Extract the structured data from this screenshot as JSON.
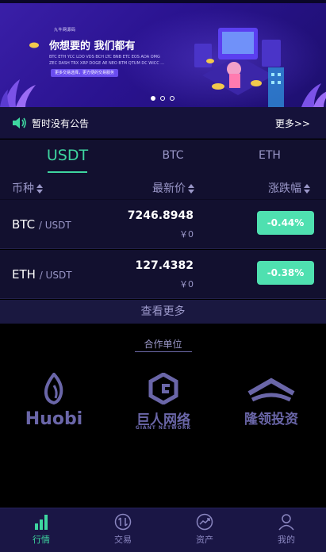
{
  "banner": {
    "brand": "九牛网源码",
    "headline": "你想要的 我们都有",
    "subtitle": "BTC ETH YCC LDO VDS BCH LTC BNB ETC EOS ADA OMG ZEC DASH TRX XRP DOGE AE NEO BTM QTUM DC WICC ...",
    "cta": "更多交易选择，更方便的交易服务",
    "slides": 3,
    "active_slide": 1
  },
  "notice": {
    "text": "暂时没有公告",
    "more": "更多>>"
  },
  "tabs": [
    {
      "label": "USDT",
      "active": true
    },
    {
      "label": "BTC",
      "active": false
    },
    {
      "label": "ETH",
      "active": false
    }
  ],
  "table": {
    "headers": {
      "coin": "币种",
      "price": "最新价",
      "change": "涨跌幅"
    },
    "rows": [
      {
        "base": "BTC",
        "quote": "/ USDT",
        "price": "7246.8948",
        "cny": "￥0",
        "change": "-0.44%"
      },
      {
        "base": "ETH",
        "quote": "/ USDT",
        "price": "127.4382",
        "cny": "￥0",
        "change": "-0.38%"
      }
    ],
    "view_more": "查看更多"
  },
  "partners": {
    "title": "合作单位",
    "logos": [
      {
        "name": "Huobi",
        "icon": "huobi-flame-icon"
      },
      {
        "name": "巨人网络",
        "caption": "GIANT NETWORK",
        "icon": "giant-network-icon"
      },
      {
        "name": "隆领投资",
        "icon": "longling-icon"
      }
    ]
  },
  "nav": [
    {
      "label": "行情",
      "icon": "chart-bars-icon",
      "active": true
    },
    {
      "label": "交易",
      "icon": "exchange-icon",
      "active": false
    },
    {
      "label": "资产",
      "icon": "trend-icon",
      "active": false
    },
    {
      "label": "我的",
      "icon": "user-icon",
      "active": false
    }
  ],
  "colors": {
    "accent": "#3ed6a0",
    "change_badge": "#4fe0b0",
    "background": "#12102f",
    "muted": "#9a97c8"
  }
}
